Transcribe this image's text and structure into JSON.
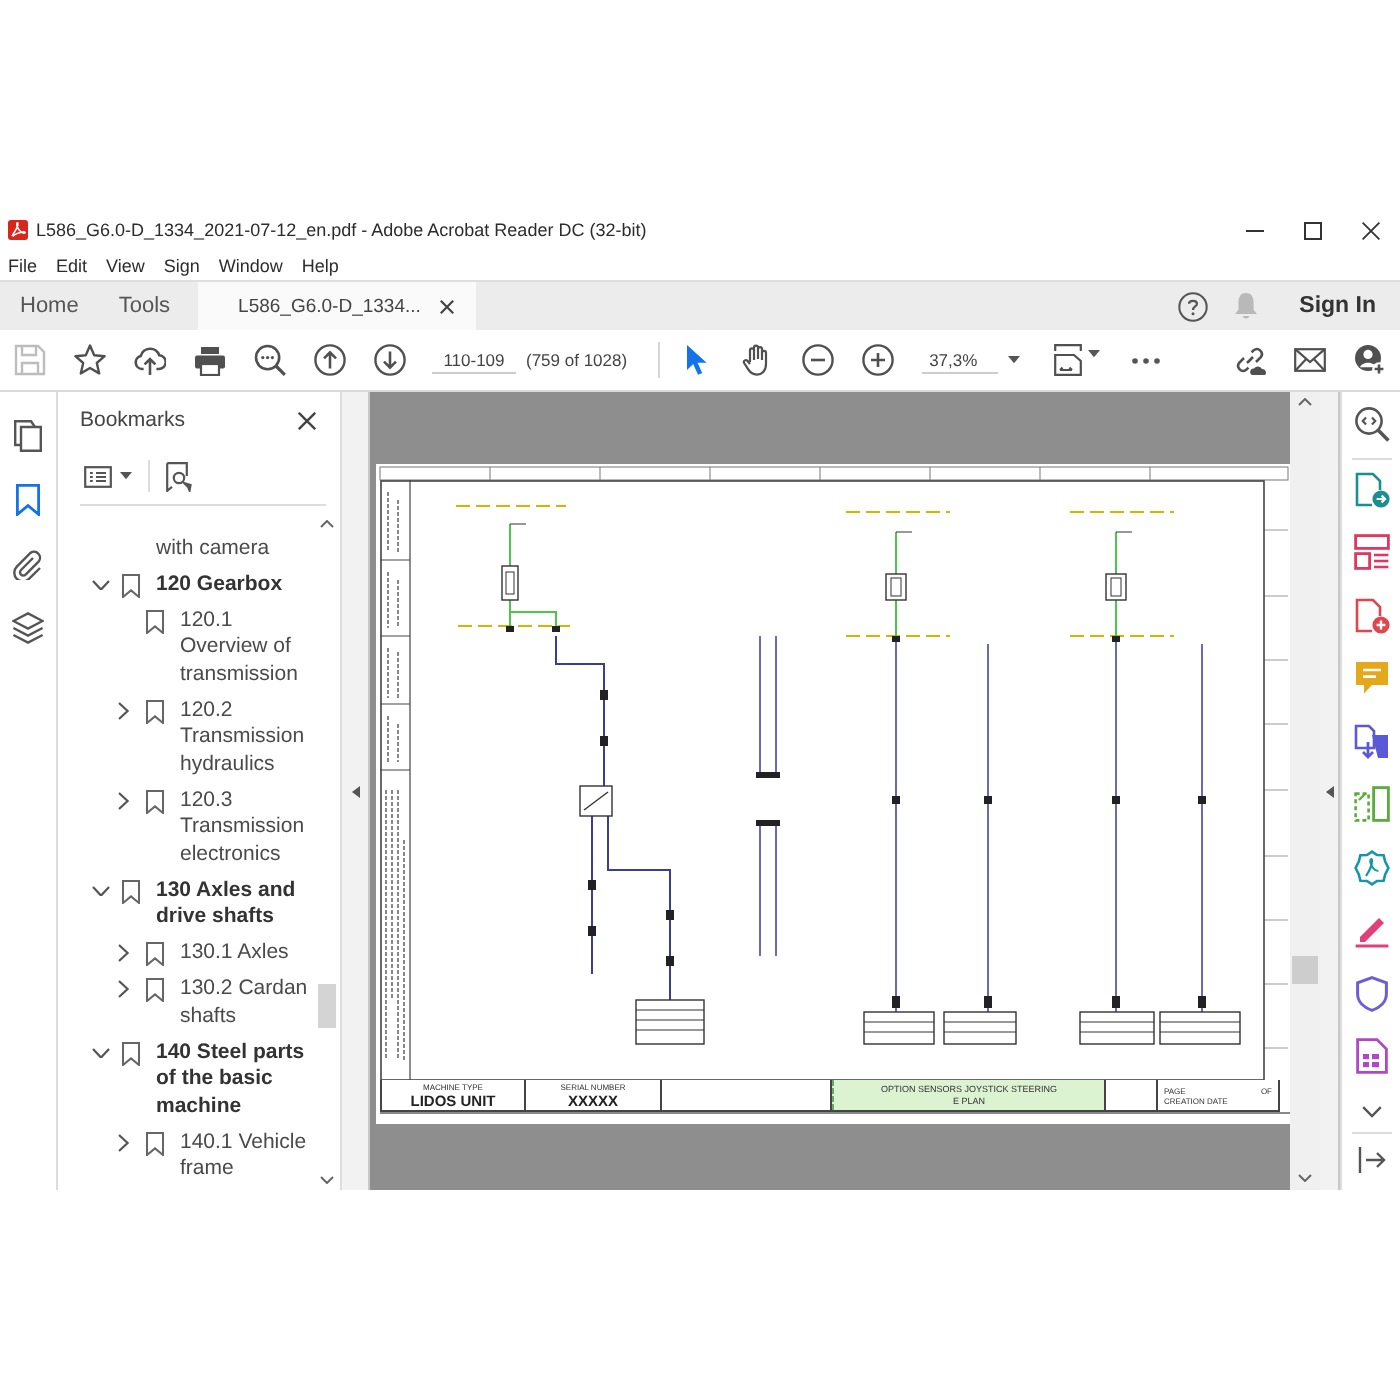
{
  "window": {
    "title": "L586_G6.0-D_1334_2021-07-12_en.pdf - Adobe Acrobat Reader DC (32-bit)"
  },
  "menu": [
    "File",
    "Edit",
    "View",
    "Sign",
    "Window",
    "Help"
  ],
  "tabs": [
    {
      "label": "Home",
      "selected": false,
      "closable": false
    },
    {
      "label": "Tools",
      "selected": false,
      "closable": false
    },
    {
      "label": "L586_G6.0-D_1334...",
      "selected": true,
      "closable": true
    }
  ],
  "account": {
    "sign_in": "Sign In"
  },
  "toolbar": {
    "save_disabled": true,
    "page_field": {
      "value": "110-109"
    },
    "page_count": "(759 of 1028)",
    "select_tools": [
      {
        "selected": true
      },
      {
        "selected": false
      }
    ],
    "zoom_field": {
      "value": "37,3%"
    }
  },
  "left_rail": [
    {
      "selected": false
    },
    {
      "selected": true
    },
    {
      "selected": false
    },
    {
      "selected": false
    }
  ],
  "bookmarks": {
    "title": "Bookmarks",
    "items": [
      {
        "kind": "continuation",
        "label": "with camera"
      },
      {
        "kind": "folder",
        "label": "120 Gearbox",
        "expanded": true,
        "children": [
          {
            "kind": "leaf",
            "label": "120.1 Overview of transmission"
          },
          {
            "kind": "folder",
            "label": "120.2 Transmission hydraulics",
            "expanded": false
          },
          {
            "kind": "folder",
            "label": "120.3 Transmission electronics",
            "expanded": false
          }
        ]
      },
      {
        "kind": "folder",
        "label": "130 Axles and drive shafts",
        "expanded": true,
        "children": [
          {
            "kind": "folder",
            "label": "130.1 Axles",
            "expanded": false
          },
          {
            "kind": "folder",
            "label": "130.2 Cardan shafts",
            "expanded": false
          }
        ]
      },
      {
        "kind": "folder",
        "label": "140 Steel parts of the basic machine",
        "expanded": true,
        "children": [
          {
            "kind": "folder",
            "label": "140.1 Vehicle frame",
            "expanded": false
          }
        ]
      }
    ]
  },
  "document": {
    "title_block": {
      "machine_type": {
        "label": "MACHINE TYPE",
        "value": "LIDOS UNIT"
      },
      "serial_number": {
        "label": "SERIAL NUMBER",
        "value": "XXXXX"
      },
      "plan_title": [
        "OPTION SENSORS JOYSTICK STEERING",
        "E PLAN"
      ],
      "page": {
        "label": "PAGE",
        "of": "OF"
      },
      "creation_date": {
        "label": "CREATION DATE"
      }
    }
  }
}
